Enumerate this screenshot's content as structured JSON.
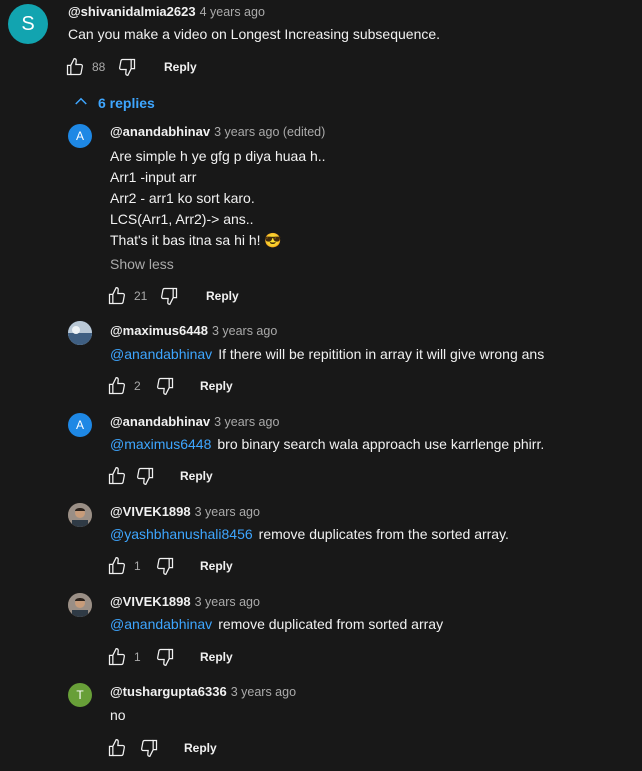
{
  "colors": {
    "background": "#181818",
    "mention": "#3ea6ff",
    "secondary": "#aaaaaa"
  },
  "top_comment": {
    "avatar_letter": "S",
    "avatar_color": "#12a4b0",
    "author": "@shivanidalmia2623",
    "time": "4 years ago",
    "text": "Can you make a video on Longest Increasing subsequence.",
    "likes": "88",
    "reply_label": "Reply"
  },
  "replies_toggle": {
    "label": "6 replies",
    "icon": "chevron-up-icon"
  },
  "replies": [
    {
      "avatar_letter": "A",
      "avatar_color": "#1e88e5",
      "author": "@anandabhinav",
      "time": "3 years ago (edited)",
      "lines": [
        "Are simple h ye gfg p diya huaa h..",
        "Arr1 -input arr",
        "Arr2 - arr1 ko sort karo.",
        "LCS(Arr1, Arr2)-> ans..",
        "That's it bas itna sa hi h! 😎"
      ],
      "show_less": "Show less",
      "likes": "21",
      "reply_label": "Reply"
    },
    {
      "avatar_letter": "",
      "avatar_color": "#5a7ea0",
      "author": "@maximus6448",
      "time": "3 years ago",
      "mention": "@anandabhinav",
      "text": "If there will be repitition in array it will give wrong ans",
      "likes": "2",
      "reply_label": "Reply"
    },
    {
      "avatar_letter": "A",
      "avatar_color": "#1e88e5",
      "author": "@anandabhinav",
      "time": "3 years ago",
      "mention": "@maximus6448",
      "text": "bro binary search wala approach use karrlenge phirr.",
      "likes": "",
      "reply_label": "Reply"
    },
    {
      "avatar_letter": "",
      "avatar_color": "#6b5a4a",
      "author": "@VIVEK1898",
      "time": "3 years ago",
      "mention": "@yashbhanushali8456",
      "text": "remove duplicates from the sorted array.",
      "likes": "1",
      "reply_label": "Reply"
    },
    {
      "avatar_letter": "",
      "avatar_color": "#6b5a4a",
      "author": "@VIVEK1898",
      "time": "3 years ago",
      "mention": "@anandabhinav",
      "text": "remove duplicated from sorted array",
      "likes": "1",
      "reply_label": "Reply"
    },
    {
      "avatar_letter": "T",
      "avatar_color": "#689f38",
      "author": "@tushargupta6336",
      "time": "3 years ago",
      "text": "no",
      "likes": "",
      "reply_label": "Reply"
    }
  ]
}
